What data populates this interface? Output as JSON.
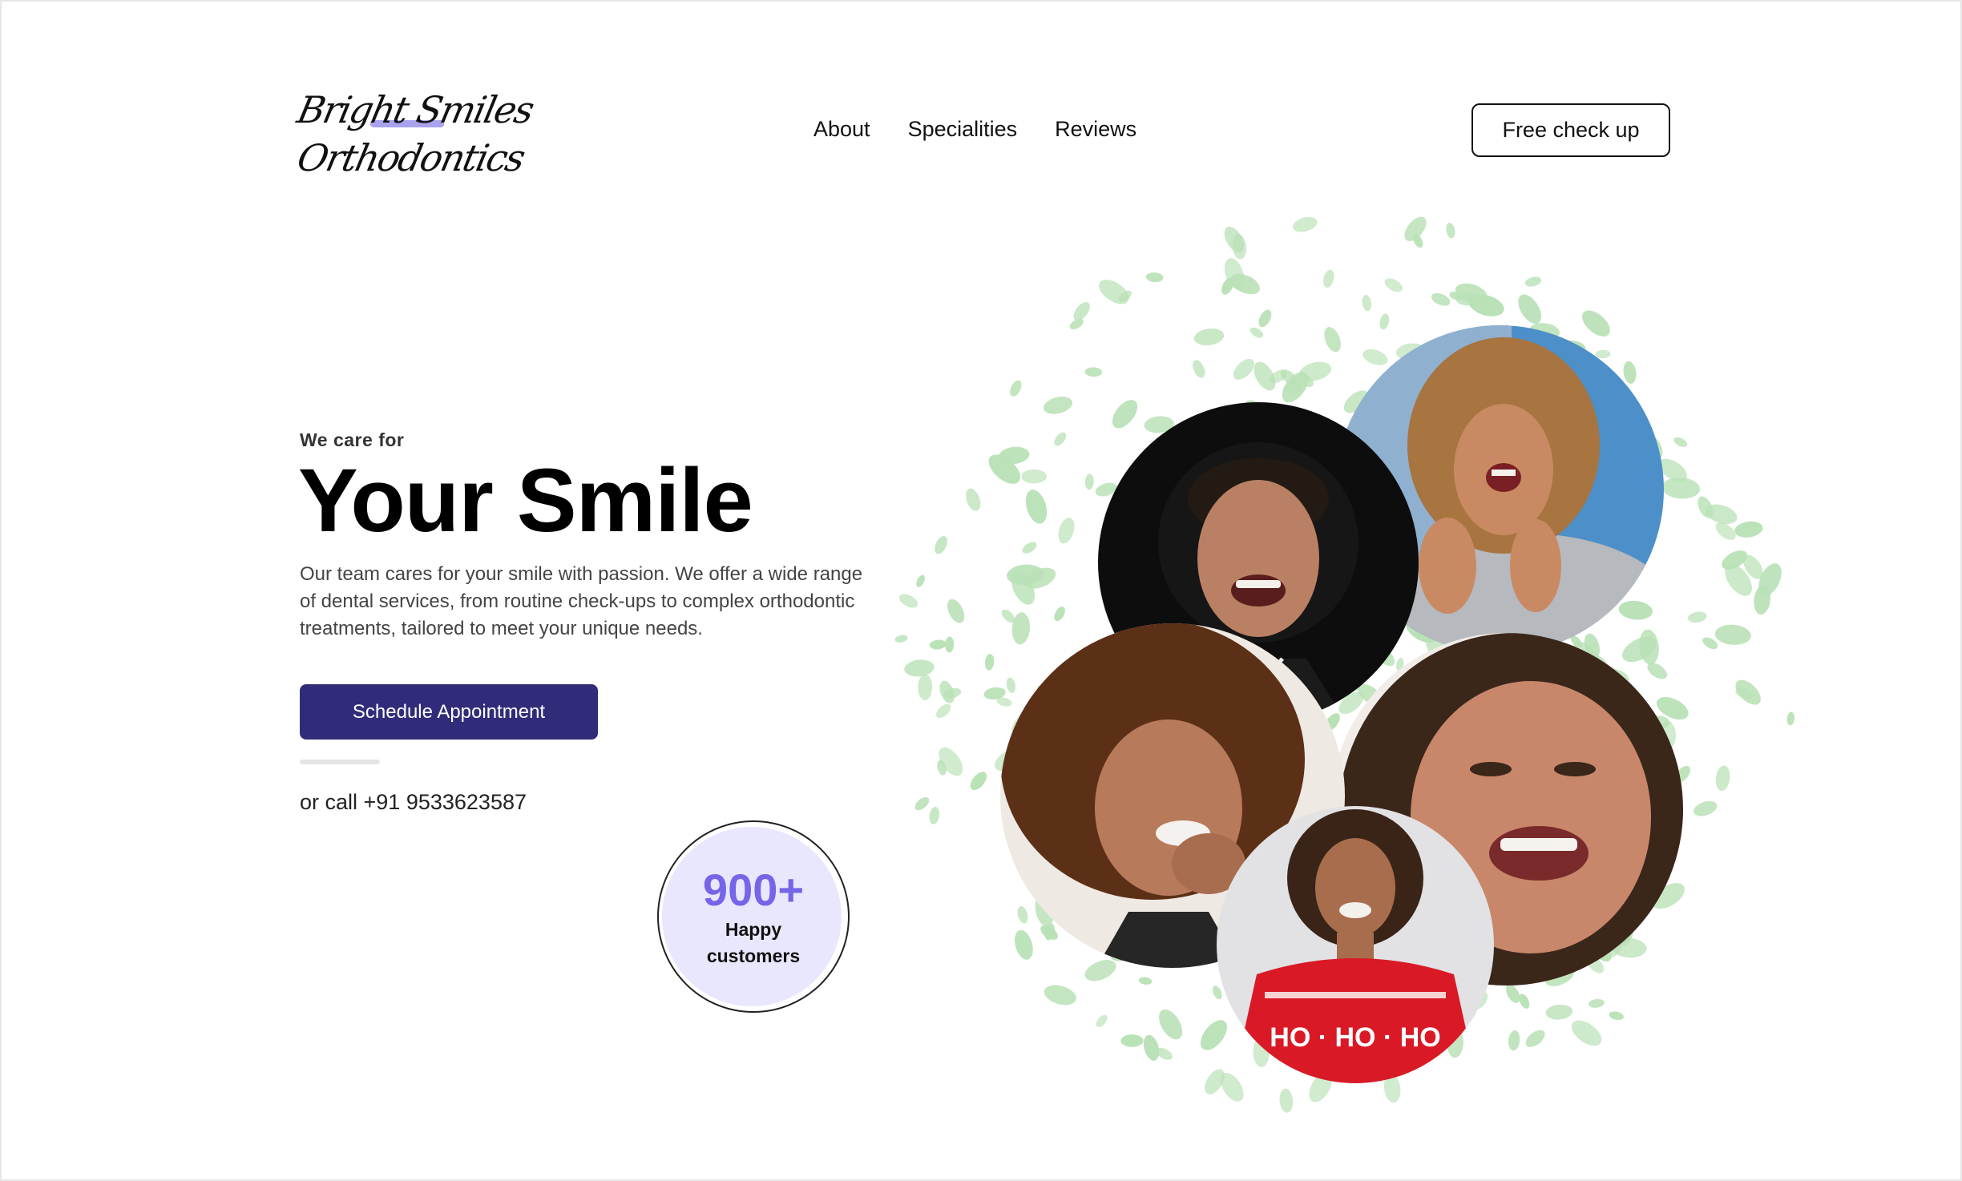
{
  "header": {
    "logo": {
      "line1": "Bright Smiles",
      "line2": "Orthodontics"
    },
    "nav": [
      {
        "label": "About"
      },
      {
        "label": "Specialities"
      },
      {
        "label": "Reviews"
      }
    ],
    "cta_label": "Free check up"
  },
  "hero": {
    "eyebrow": "We care for",
    "title": "Your Smile",
    "description": "Our team cares for your smile with passion. We offer a wide range of dental services, from routine check-ups to complex orthodontic treatments, tailored to meet your unique needs.",
    "schedule_label": "Schedule Appointment",
    "call_text": "or call +91 9533623587"
  },
  "badge": {
    "number": "900+",
    "label_line1": "Happy",
    "label_line2": "customers"
  },
  "colors": {
    "primary": "#312c7a",
    "accent": "#7565e8",
    "badge_bg": "#e9e7fd",
    "leaf": "#b9e1b6",
    "logo_highlight": "#a9a3ee"
  },
  "collage": {
    "photos": [
      {
        "name": "man-dark-background"
      },
      {
        "name": "curly-woman-blue-background"
      },
      {
        "name": "woman-afro"
      },
      {
        "name": "woman-laughing-closeup"
      },
      {
        "name": "woman-red-sweater",
        "sweater_text": "HO · HO · HO"
      }
    ]
  }
}
